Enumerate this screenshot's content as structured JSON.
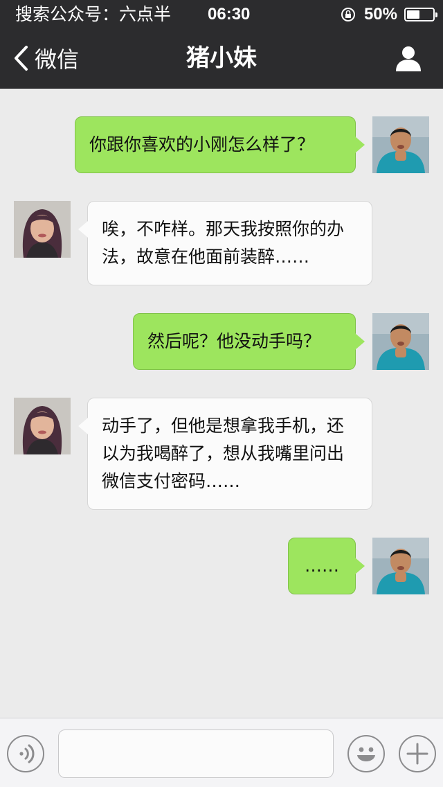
{
  "status_bar": {
    "left_text": "搜索公众号：六点半",
    "time": "06:30",
    "battery_percent": "50%",
    "battery_level": 0.5,
    "icons": [
      "rotation-lock-icon",
      "battery-icon"
    ]
  },
  "nav": {
    "back_label": "微信",
    "title": "猪小妹",
    "icons": [
      "back-chevron-icon",
      "profile-icon"
    ]
  },
  "messages": [
    {
      "side": "sent",
      "text": "你跟你喜欢的小刚怎么样了？"
    },
    {
      "side": "received",
      "text": "唉，不咋样。那天我按照你的办法，故意在他面前装醉……"
    },
    {
      "side": "sent",
      "text": "然后呢？他没动手吗？"
    },
    {
      "side": "received",
      "text": "动手了，但他是想拿我手机，还以为我喝醉了，想从我嘴里问出微信支付密码……"
    },
    {
      "side": "sent",
      "text": "……"
    }
  ],
  "input_bar": {
    "value": "",
    "icons": [
      "voice-icon",
      "emoji-icon",
      "plus-icon"
    ]
  },
  "colors": {
    "bar_background": "#2c2c2e",
    "chat_background": "#ebebeb",
    "sent_bubble": "#9de55e",
    "received_bubble": "#fbfbfb"
  }
}
